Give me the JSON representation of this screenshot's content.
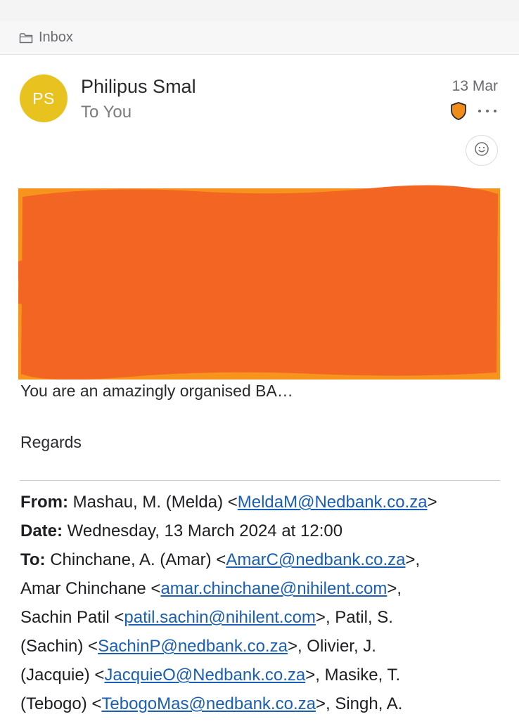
{
  "folder": {
    "icon": "folder-icon",
    "label": "Inbox"
  },
  "message": {
    "avatar_initials": "PS",
    "avatar_color": "#e8c31f",
    "sender": "Philipus Smal",
    "to_line": "To You",
    "date": "13 Mar",
    "body_line1": "You are an amazingly organised BA…",
    "body_line2": "Regards"
  },
  "colors": {
    "redaction": "#f26522",
    "link": "#1a5fb4",
    "shield": "#f08c1a"
  },
  "quoted": {
    "from_label": "From:",
    "from_name": " Mashau, M. (Melda) <",
    "from_email": "MeldaM@Nedbank.co.za",
    "from_close": ">",
    "date_label": "Date:",
    "date_value": " Wednesday, 13 March 2024 at 12:00",
    "to_label": "To:",
    "r1_name": " Chinchane, A. (Amar) <",
    "r1_email": "AmarC@nedbank.co.za",
    "r1_close": ">,",
    "r2_name": "Amar Chinchane <",
    "r2_email": "amar.chinchane@nihilent.com",
    "r2_close": ">,",
    "r3_name": "Sachin Patil <",
    "r3_email": "patil.sachin@nihilent.com",
    "r3_close": ">, Patil, S.",
    "r4_name": "(Sachin) <",
    "r4_email": "SachinP@nedbank.co.za",
    "r4_close": ">, Olivier, J.",
    "r5_name": "(Jacquie) <",
    "r5_email": "JacquieO@Nedbank.co.za",
    "r5_close": ">, Masike, T.",
    "r6_name": "(Tebogo) <",
    "r6_email": "TebogoMas@nedbank.co.za",
    "r6_close": ">, Singh, A."
  }
}
